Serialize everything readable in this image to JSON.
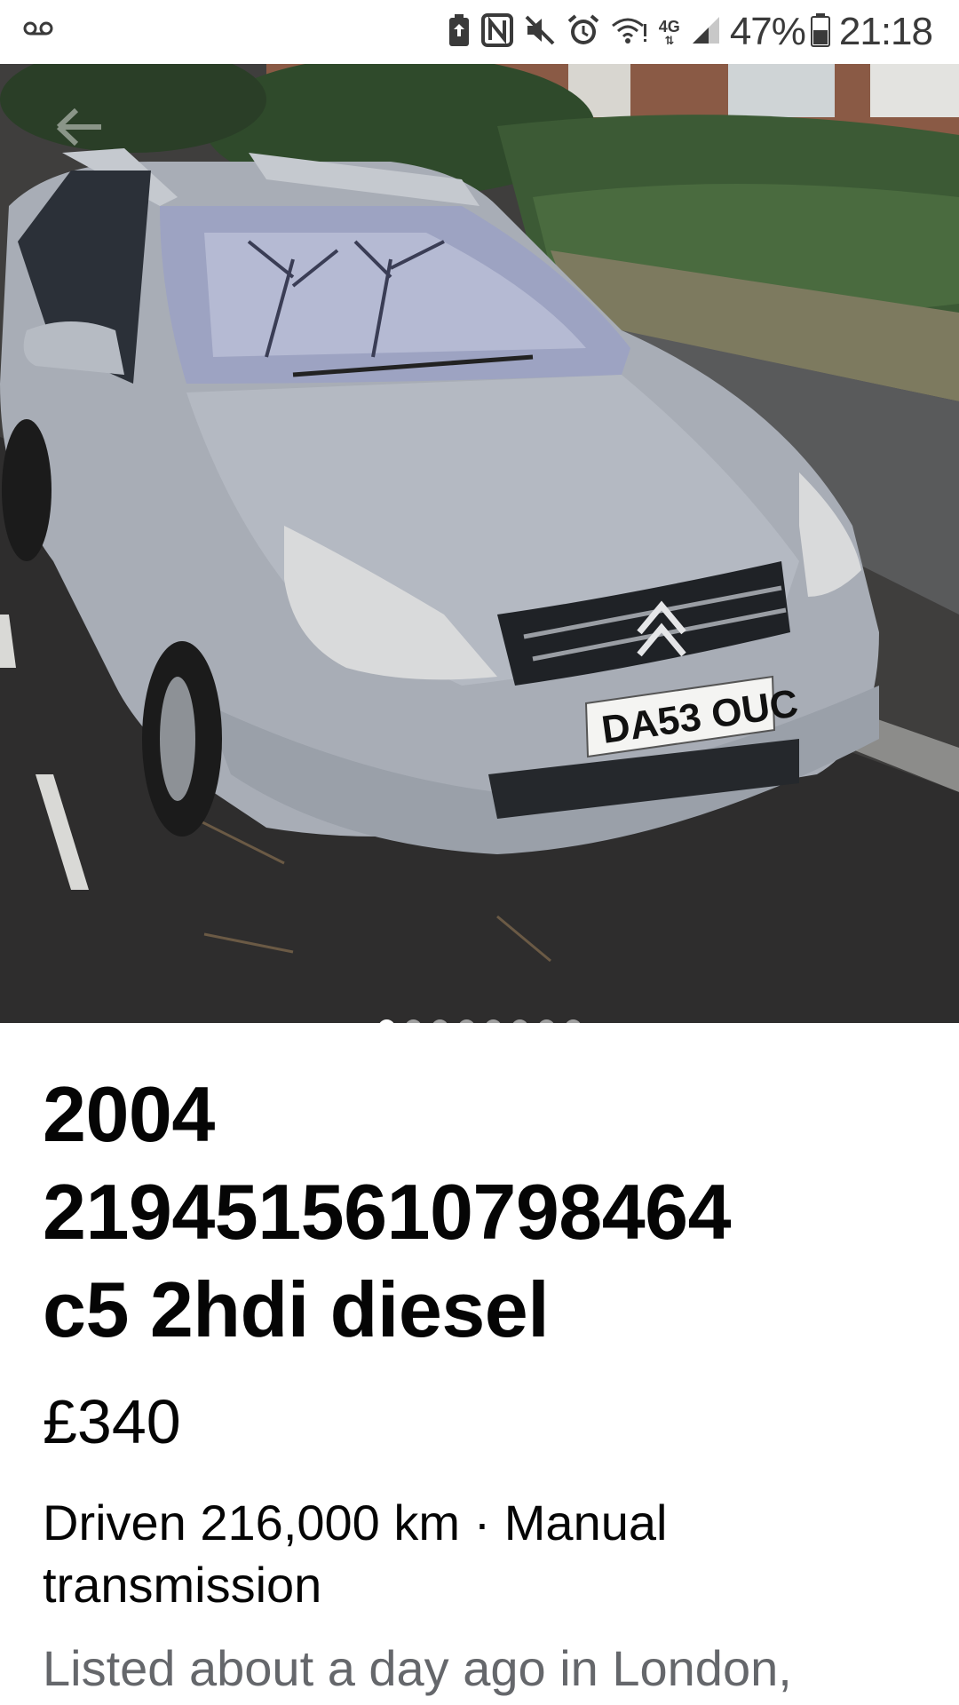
{
  "status_bar": {
    "voicemail_icon": "voicemail-icon",
    "icons": [
      "battery-saver-icon",
      "nfc-icon",
      "mute-icon",
      "alarm-icon",
      "wifi-icon"
    ],
    "network_type": "4G",
    "battery_percent": "47%",
    "time": "21:18"
  },
  "gallery": {
    "photo_description_icon": "car-photo",
    "plate_text": "DA53 OUC",
    "total_photos": 8,
    "current_photo": 1
  },
  "listing": {
    "title_line1": "2004",
    "title_line2": "219451561079846​4",
    "title_line3": "c5 2hdi diesel",
    "price": "£340",
    "specs_line1": "Driven 216,000 km · Manual",
    "specs_line2": "transmission",
    "listed": "Listed about a day ago in London,"
  },
  "colors": {
    "title": "#050505",
    "secondary_text": "#65676b",
    "status_text": "#3a3a3a"
  }
}
